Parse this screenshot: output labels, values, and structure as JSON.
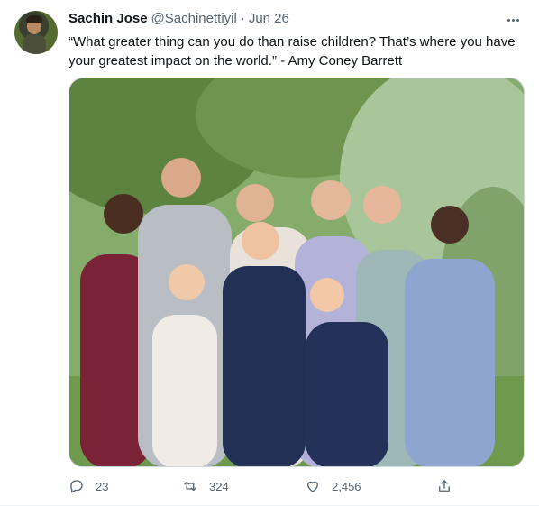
{
  "tweet": {
    "author_name": "Sachin Jose",
    "handle": "@Sachinettiyil",
    "separator": "·",
    "date": "Jun 26",
    "text": "“What greater thing can you do than raise children? That’s where you have your greatest impact on the world.” - Amy Coney Barrett",
    "media_icon": "family-photo",
    "stats": {
      "replies": "23",
      "retweets": "324",
      "likes": "2,456"
    }
  },
  "icons": {
    "reply": "reply-icon",
    "retweet": "retweet-icon",
    "like": "heart-icon",
    "share": "share-icon",
    "more": "more-icon"
  },
  "colors": {
    "text": "#0f1419",
    "secondary": "#536471",
    "border": "#cfd9de"
  }
}
